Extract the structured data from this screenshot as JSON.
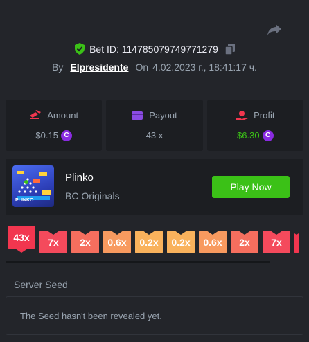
{
  "header": {
    "share_icon": "share-icon",
    "bet_id": "Bet ID: 114785079749771279",
    "verified_icon": "shield-check-icon",
    "copy_icon": "copy-icon",
    "by_label": "By",
    "username": "Elpresidente",
    "on_label": "On",
    "datetime": "4.02.2023 г., 18:41:17 ч."
  },
  "stats": {
    "amount": {
      "label": "Amount",
      "value": "$0.15",
      "icon": "bet-icon"
    },
    "payout": {
      "label": "Payout",
      "value": "43 x",
      "icon": "wallet-icon"
    },
    "profit": {
      "label": "Profit",
      "value": "$6.30",
      "icon": "profit-icon"
    },
    "coin_symbol": "C"
  },
  "game": {
    "name": "Plinko",
    "provider": "BC Originals",
    "play_label": "Play Now",
    "thumb_label": "PLINKO"
  },
  "multipliers": [
    {
      "label": "43x",
      "color": "#f2364f",
      "active": true
    },
    {
      "label": "7x",
      "color": "#f44a5c",
      "active": false
    },
    {
      "label": "2x",
      "color": "#f66e5e",
      "active": false
    },
    {
      "label": "0.6x",
      "color": "#f89a5f",
      "active": false
    },
    {
      "label": "0.2x",
      "color": "#f9b25c",
      "active": false
    },
    {
      "label": "0.2x",
      "color": "#f9b25c",
      "active": false
    },
    {
      "label": "0.6x",
      "color": "#f89a5f",
      "active": false
    },
    {
      "label": "2x",
      "color": "#f66e5e",
      "active": false
    },
    {
      "label": "7x",
      "color": "#f44a5c",
      "active": false
    },
    {
      "label": "",
      "color": "#f2364f",
      "active": false
    }
  ],
  "seed": {
    "label": "Server Seed",
    "text": "The Seed hasn't been revealed yet."
  },
  "colors": {
    "background": "#23252a",
    "card": "#1c1e22",
    "accent_green": "#3bc117",
    "muted": "#99a4b0",
    "coin": "#8a2be2"
  }
}
